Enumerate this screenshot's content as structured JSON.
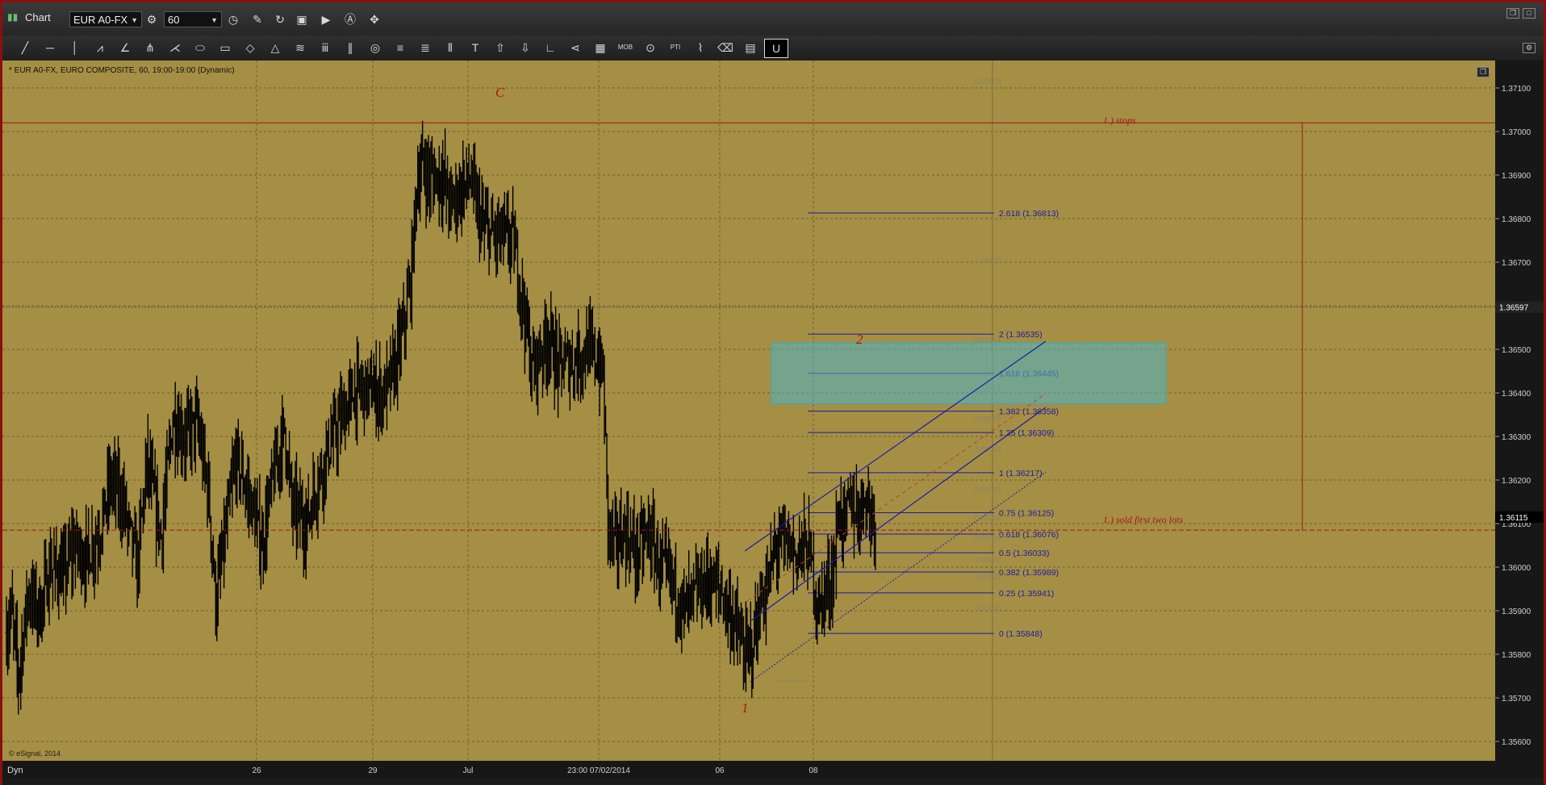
{
  "window": {
    "title": "Chart",
    "symbol": "EUR A0-FX",
    "interval": "60"
  },
  "toolbar": {
    "tools": [
      "line-tool",
      "horizontal-line-tool",
      "vertical-line-tool",
      "trend-tool",
      "angle-tool",
      "pitchfork-tool",
      "gann-fan-tool",
      "ellipse-tool",
      "rectangle-tool",
      "diamond-tool",
      "triangle-tool",
      "regression-tool",
      "cycle-tool",
      "parallel-lines-tool",
      "circle-tool",
      "fib-retracement-tool",
      "fib-extension-tool",
      "fib-timezone-tool",
      "text-tool",
      "up-arrow-tool",
      "down-arrow-tool",
      "angle-measure-tool",
      "back-arrow-tool",
      "grid-tool",
      "mob-tool",
      "eye-tool",
      "pti-tool",
      "zigzag-tool",
      "eraser-tool",
      "note-tool",
      "magnet-tool"
    ],
    "mob_label": "MOB",
    "pti_label": "PTI",
    "magnet_label": "U"
  },
  "chart_info": {
    "header": "* EUR A0-FX, EURO COMPOSITE, 60, 19:00-19:00 (Dynamic)",
    "copyright": "© eSignal, 2014",
    "footer_mode": "Dyn"
  },
  "chart_data": {
    "type": "bar",
    "background": "#a58f44",
    "bar_color": "#000000",
    "y_axis": {
      "ylim": [
        1.355,
        1.3718
      ],
      "ticks": [
        "1.37100",
        "1.37000",
        "1.36900",
        "1.36800",
        "1.36700",
        "1.36600",
        "1.36500",
        "1.36400",
        "1.36300",
        "1.36200",
        "1.36100",
        "1.36000",
        "1.35900",
        "1.35800",
        "1.35700",
        "1.35600"
      ],
      "current_price_label": "1.36115",
      "hair_price_label": "1.36597"
    },
    "x_axis": {
      "labels": [
        "26",
        "29",
        "Jul",
        "23:00 07/02/2014",
        "06",
        "08"
      ]
    },
    "anchors": [
      [
        0,
        1.3585
      ],
      [
        4,
        1.359
      ],
      [
        10,
        1.3575
      ],
      [
        18,
        1.3594
      ],
      [
        28,
        1.359
      ],
      [
        37,
        1.36
      ],
      [
        48,
        1.3598
      ],
      [
        57,
        1.3605
      ],
      [
        67,
        1.3602
      ],
      [
        78,
        1.3608
      ],
      [
        88,
        1.362
      ],
      [
        98,
        1.3615
      ],
      [
        110,
        1.36
      ],
      [
        118,
        1.3624
      ],
      [
        130,
        1.3607
      ],
      [
        140,
        1.3634
      ],
      [
        150,
        1.363
      ],
      [
        160,
        1.3633
      ],
      [
        170,
        1.3617
      ],
      [
        176,
        1.3592
      ],
      [
        184,
        1.3607
      ],
      [
        193,
        1.3625
      ],
      [
        205,
        1.3615
      ],
      [
        215,
        1.3605
      ],
      [
        224,
        1.362
      ],
      [
        234,
        1.3632
      ],
      [
        240,
        1.3614
      ],
      [
        252,
        1.361
      ],
      [
        263,
        1.3621
      ],
      [
        272,
        1.3628
      ],
      [
        282,
        1.3634
      ],
      [
        292,
        1.364
      ],
      [
        300,
        1.3641
      ],
      [
        310,
        1.364
      ],
      [
        318,
        1.364
      ],
      [
        326,
        1.3645
      ],
      [
        334,
        1.3655
      ],
      [
        340,
        1.3665
      ],
      [
        345,
        1.3688
      ],
      [
        350,
        1.3692
      ],
      [
        357,
        1.3689
      ],
      [
        366,
        1.369
      ],
      [
        374,
        1.3683
      ],
      [
        382,
        1.3687
      ],
      [
        390,
        1.3689
      ],
      [
        400,
        1.3678
      ],
      [
        410,
        1.3676
      ],
      [
        418,
        1.3676
      ],
      [
        426,
        1.3675
      ],
      [
        435,
        1.366
      ],
      [
        442,
        1.3645
      ],
      [
        448,
        1.3649
      ],
      [
        456,
        1.3653
      ],
      [
        464,
        1.3646
      ],
      [
        472,
        1.3647
      ],
      [
        480,
        1.3648
      ],
      [
        488,
        1.365
      ],
      [
        496,
        1.3648
      ],
      [
        502,
        1.3644
      ],
      [
        506,
        1.361
      ],
      [
        512,
        1.3605
      ],
      [
        520,
        1.3608
      ],
      [
        530,
        1.3603
      ],
      [
        540,
        1.3608
      ],
      [
        550,
        1.36
      ],
      [
        560,
        1.3597
      ],
      [
        570,
        1.359
      ],
      [
        580,
        1.3594
      ],
      [
        590,
        1.3597
      ],
      [
        600,
        1.3595
      ],
      [
        608,
        1.359
      ],
      [
        615,
        1.3585
      ],
      [
        622,
        1.3579
      ],
      [
        628,
        1.3583
      ],
      [
        634,
        1.3591
      ],
      [
        640,
        1.3595
      ],
      [
        646,
        1.3604
      ],
      [
        652,
        1.3606
      ],
      [
        658,
        1.3605
      ],
      [
        664,
        1.3603
      ],
      [
        670,
        1.3605
      ],
      [
        676,
        1.3603
      ],
      [
        680,
        1.3595
      ],
      [
        684,
        1.359
      ],
      [
        688,
        1.3595
      ],
      [
        692,
        1.3596
      ],
      [
        696,
        1.36
      ],
      [
        700,
        1.3613
      ],
      [
        705,
        1.361
      ],
      [
        710,
        1.3615
      ],
      [
        716,
        1.3612
      ],
      [
        722,
        1.3617
      ],
      [
        728,
        1.3612
      ],
      [
        731,
        1.3611
      ]
    ],
    "bars_count": 732,
    "fib_levels": [
      {
        "label": "2.618 (1.36813)",
        "price": 1.36813
      },
      {
        "label": "2 (1.36535)",
        "price": 1.36535
      },
      {
        "label": "1.618 (1.36445)",
        "price": 1.36445
      },
      {
        "label": "1.382 (1.36358)",
        "price": 1.36358
      },
      {
        "label": "1.25 (1.36309)",
        "price": 1.36309
      },
      {
        "label": "1 (1.36217)",
        "price": 1.36217
      },
      {
        "label": "0.75 (1.36125)",
        "price": 1.36125
      },
      {
        "label": "0.618 (1.36076)",
        "price": 1.36076
      },
      {
        "label": "0.5 (1.36033)",
        "price": 1.36033
      },
      {
        "label": "0.382 (1.35989)",
        "price": 1.35989
      },
      {
        "label": "0.25 (1.35941)",
        "price": 1.35941
      },
      {
        "label": "0 (1.35848)",
        "price": 1.35848
      }
    ],
    "faint_levels": [
      "0.00603",
      "0.00329",
      "0.00114",
      "0.00087",
      "0.00058",
      "0.00092",
      "0.00092",
      "0.00036",
      "0.00054",
      "0.00042",
      "0.00042",
      "0.00093"
    ],
    "annotations": {
      "wave_c": "C",
      "wave_2": "2",
      "wave_1": "1",
      "stops": "1.) stops",
      "sold": "1.) sold first two lots"
    },
    "levels": {
      "stops": 1.3702,
      "sold": 1.36085,
      "target_zone": [
        1.36375,
        1.36515
      ]
    },
    "colors": {
      "fib": "#1a1aa8",
      "annotation": "#b01414",
      "zone": "#4fb5c7"
    }
  }
}
